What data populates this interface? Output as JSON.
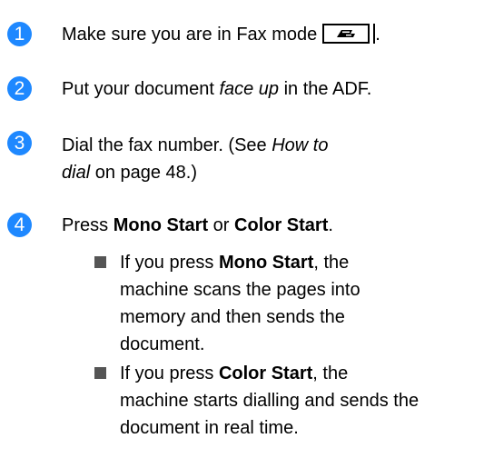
{
  "steps": [
    {
      "number": "1",
      "text_a": "Make sure you are in Fax mode",
      "key_icon": "fax-mode-key-icon"
    },
    {
      "number": "2",
      "text_a": "Put your document ",
      "text_b_italic": "face up",
      "text_c": " in the ADF."
    },
    {
      "number": "3",
      "line1_a": "Dial the fax number. (See ",
      "line1_b_italic": "How to",
      "line2_a_italic": "dial",
      "line2_b": " on page 48.)"
    },
    {
      "number": "4",
      "text_a": "Press ",
      "text_b_bold": "Mono Start",
      "text_c": " or ",
      "text_d_bold": "Color Start",
      "text_e": "."
    }
  ],
  "bullets": [
    {
      "line1_a": "If you press ",
      "line1_b_bold": "Mono Start",
      "line1_c": ", the",
      "line2": "machine scans the pages into",
      "line3": "memory and then sends the",
      "line4": "document."
    },
    {
      "line1_a": "If you press ",
      "line1_b_bold": "Color Start",
      "line1_c": ", the",
      "line2": "machine starts dialling and sends the",
      "line3": "document in real time."
    }
  ],
  "colors": {
    "badge": "#1e88ff",
    "bullet": "#555555",
    "text": "#000000"
  }
}
